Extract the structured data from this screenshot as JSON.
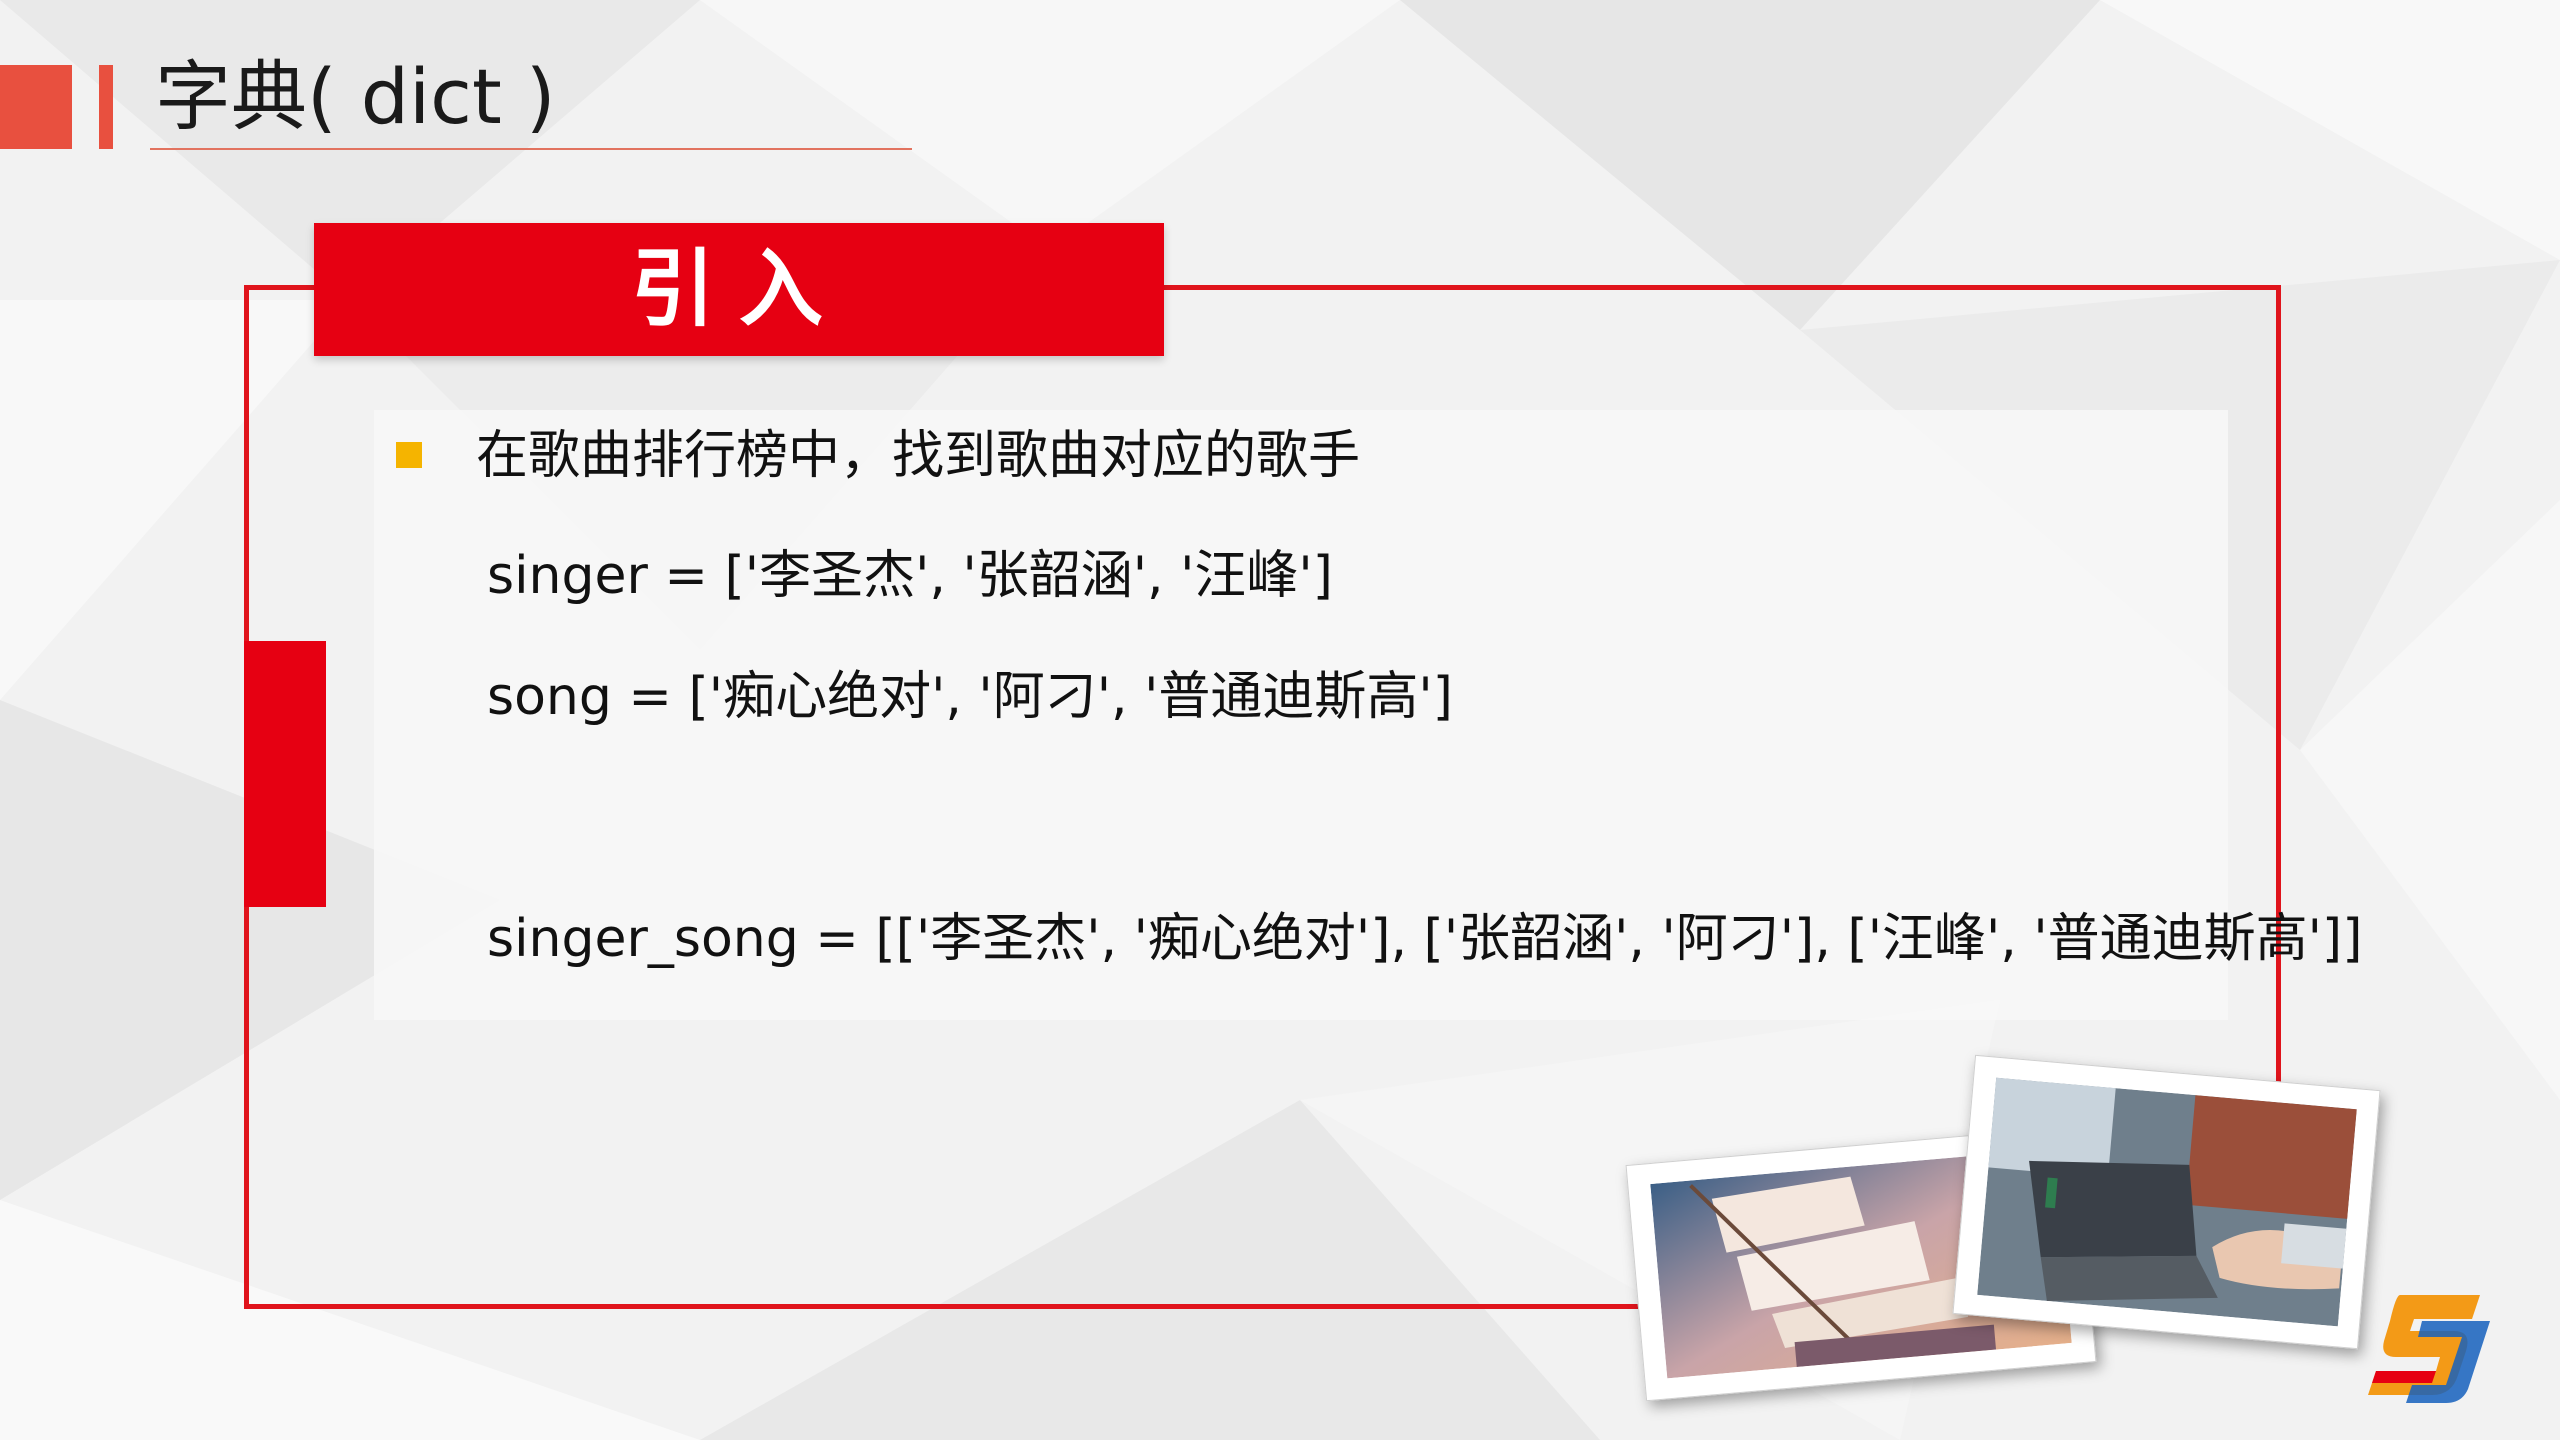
{
  "header": {
    "title": "字典( dict )"
  },
  "section": {
    "tab_label": "引入"
  },
  "content": {
    "prompt": "在歌曲排行榜中，找到歌曲对应的歌手",
    "code_lines": [
      "singer = ['李圣杰', '张韶涵', '汪峰']",
      "song = ['痴心绝对', '阿刁', '普通迪斯高']",
      "singer_song = [['李圣杰', '痴心绝对'], ['张韶涵', '阿刁'], ['汪峰', '普通迪斯高']]"
    ]
  },
  "colors": {
    "accent_red": "#e60012",
    "header_red": "#e8503f",
    "bullet_yellow": "#f5b400"
  },
  "images": {
    "photo_1": "sailing-ship-photo",
    "photo_2": "laptop-typing-photo",
    "logo": "brand-logo-sj"
  }
}
